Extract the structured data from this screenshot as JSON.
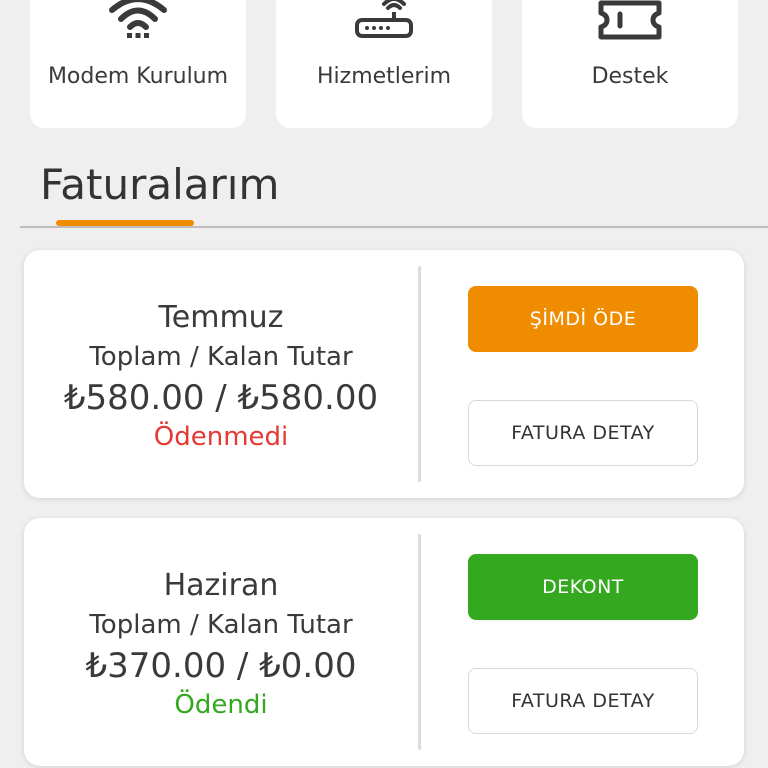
{
  "quick_actions": [
    {
      "label": "Modem Kurulum",
      "icon": "wifi-icon"
    },
    {
      "label": "Hizmetlerim",
      "icon": "router-icon"
    },
    {
      "label": "Destek",
      "icon": "ticket-icon"
    }
  ],
  "section": {
    "title": "Faturalarım",
    "accent_color": "#f08c00"
  },
  "invoices": [
    {
      "month": "Temmuz",
      "subtitle": "Toplam / Kalan Tutar",
      "amount": "₺580.00  / ₺580.00",
      "status": "Ödenmedi",
      "status_color": "#e53935",
      "primary_button": "ŞİMDİ ÖDE",
      "primary_color": "#f08c00",
      "detail_button": "FATURA DETAY"
    },
    {
      "month": "Haziran",
      "subtitle": "Toplam / Kalan Tutar",
      "amount": "₺370.00  / ₺0.00",
      "status": "Ödendi",
      "status_color": "#34a81e",
      "primary_button": "DEKONT",
      "primary_color": "#34a81e",
      "detail_button": "FATURA DETAY"
    }
  ]
}
